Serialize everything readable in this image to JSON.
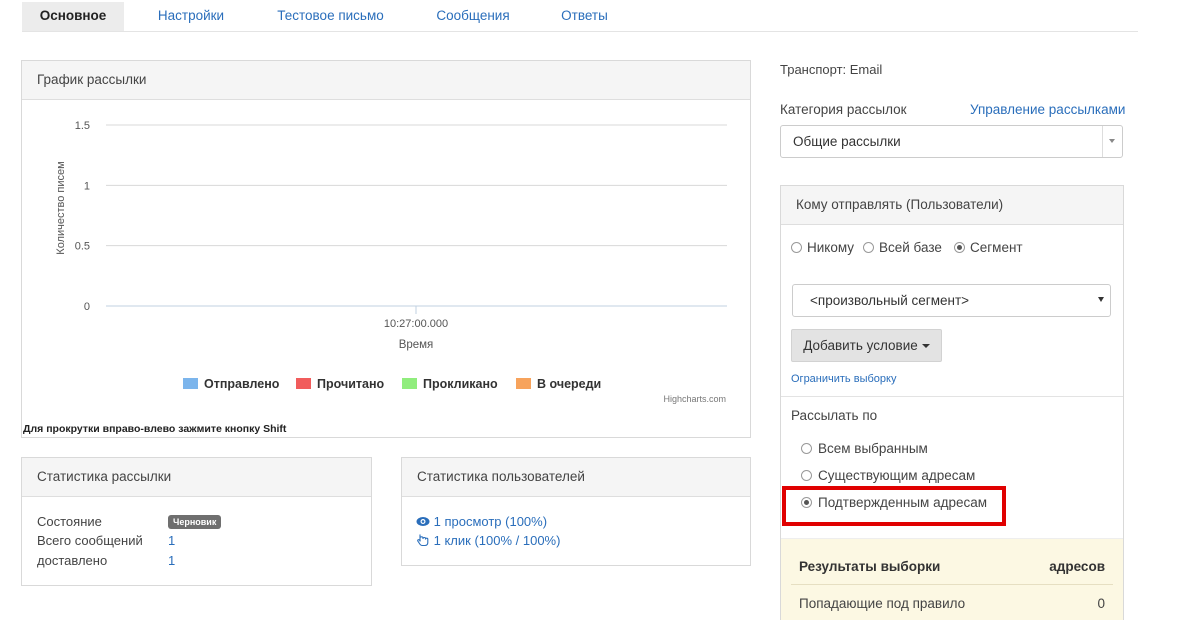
{
  "tabs": [
    {
      "label": "Основное",
      "active": true
    },
    {
      "label": "Настройки",
      "active": false
    },
    {
      "label": "Тестовое письмо",
      "active": false
    },
    {
      "label": "Сообщения",
      "active": false
    },
    {
      "label": "Ответы",
      "active": false
    }
  ],
  "chart_panel": {
    "title": "График рассылки",
    "scroll_hint": "Для прокрутки вправо-влево зажмите кнопку Shift",
    "credits": "Highcharts.com"
  },
  "chart_data": {
    "type": "line",
    "ylabel": "Количество писем",
    "xlabel": "Время",
    "y_ticks": [
      "1.5",
      "1",
      "0.5",
      "0"
    ],
    "ylim": [
      0,
      1.5
    ],
    "x_ticks": [
      "10:27:00.000"
    ],
    "grid": true,
    "legend_position": "bottom",
    "series": [
      {
        "name": "Отправлено",
        "color": "#7cb5ec",
        "values": [
          0
        ]
      },
      {
        "name": "Прочитано",
        "color": "#f15c5c",
        "values": [
          0
        ]
      },
      {
        "name": "Прокликано",
        "color": "#90ed7d",
        "values": [
          0
        ]
      },
      {
        "name": "В очереди",
        "color": "#f7a35c",
        "values": [
          0
        ]
      }
    ]
  },
  "mailing_stats": {
    "title": "Статистика рассылки",
    "status_label": "Состояние",
    "status_badge": "Черновик",
    "total_label": "Всего сообщений",
    "total_value": "1",
    "delivered_label": "доставлено",
    "delivered_value": "1"
  },
  "user_stats": {
    "title": "Статистика пользователей",
    "views": "1 просмотр (100%)",
    "clicks": "1 клик (100% / 100%)"
  },
  "right": {
    "transport": "Транспорт: Email",
    "category_label": "Категория рассылок",
    "manage_link": "Управление рассылками",
    "category_value": "Общие рассылки",
    "recipients_title": "Кому отправлять (Пользователи)",
    "recipient_options": [
      "Никому",
      "Всей базе",
      "Сегмент"
    ],
    "segment_value": "<произвольный сегмент>",
    "add_condition": "Добавить условие",
    "limit_link": "Ограничить выборку",
    "send_by_label": "Рассылать по",
    "send_by_options": [
      "Всем выбранным",
      "Существующим адресам",
      "Подтвержденным адресам"
    ],
    "highlight_color": "#e00000",
    "results_title": "Результаты выборки",
    "results_col": "адресов",
    "results_row_label": "Попадающие под правило",
    "results_row_value": "0"
  }
}
